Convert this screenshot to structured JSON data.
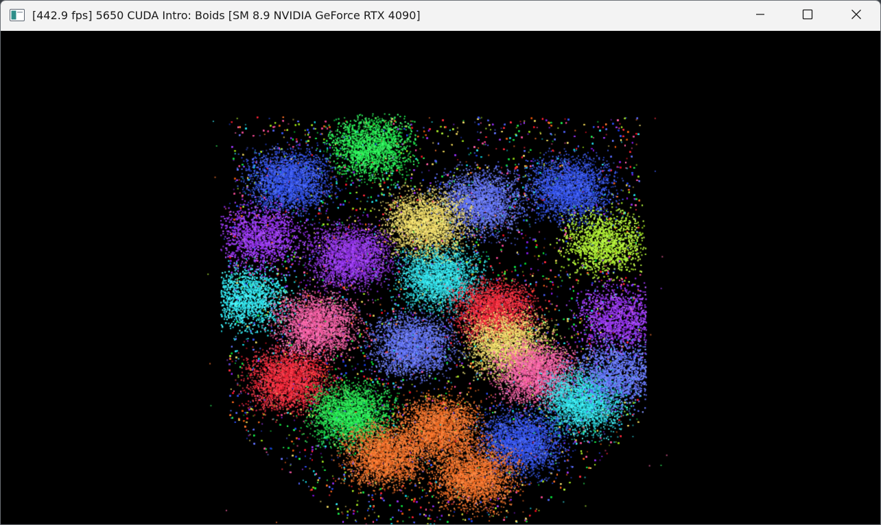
{
  "window": {
    "title": "[442.9 fps] 5650 CUDA Intro: Boids [SM 8.9 NVIDIA GeForce RTX 4090]",
    "app_icon": "app-window-icon",
    "controls": {
      "minimize_icon": "minimize-icon",
      "maximize_icon": "maximize-icon",
      "close_icon": "close-icon"
    }
  },
  "simulation": {
    "background_color": "#000000",
    "cluster_colors": [
      "#2ef05a",
      "#3d5cf5",
      "#ff3344",
      "#f5e070",
      "#9a3cf0",
      "#38e6f0",
      "#ff66aa",
      "#ff7a33",
      "#6a7bff",
      "#b2f03a"
    ]
  }
}
